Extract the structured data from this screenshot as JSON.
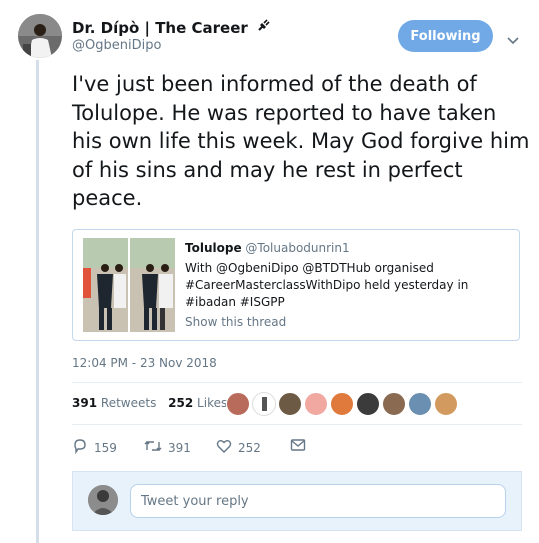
{
  "author": {
    "name": "Dr. Dípò | The Career",
    "handle": "@OgbeniDipo"
  },
  "follow_button": {
    "label": "Following"
  },
  "tweet": {
    "text": "I've just been informed of the death of Tolulope. He was reported to have taken his own life this week. May God forgive him of his sins and may he rest in perfect peace."
  },
  "quote": {
    "name": "Tolulope",
    "handle": "@Toluabodunrin1",
    "text": "With @OgbeniDipo @BTDTHub organised #CareerMasterclassWithDipo held yesterday in #ibadan #ISGPP",
    "show_thread": "Show this thread"
  },
  "timestamp": "12:04 PM - 23 Nov 2018",
  "stats": {
    "retweets_count": "391",
    "retweets_label": "Retweets",
    "likes_count": "252",
    "likes_label": "Likes"
  },
  "actions": {
    "reply_count": "159",
    "retweet_count": "391",
    "like_count": "252"
  },
  "reply": {
    "placeholder": "Tweet your reply"
  },
  "colors": {
    "accent": "#71a9e6",
    "muted_text": "#657786",
    "rule": "#d3dee8"
  }
}
